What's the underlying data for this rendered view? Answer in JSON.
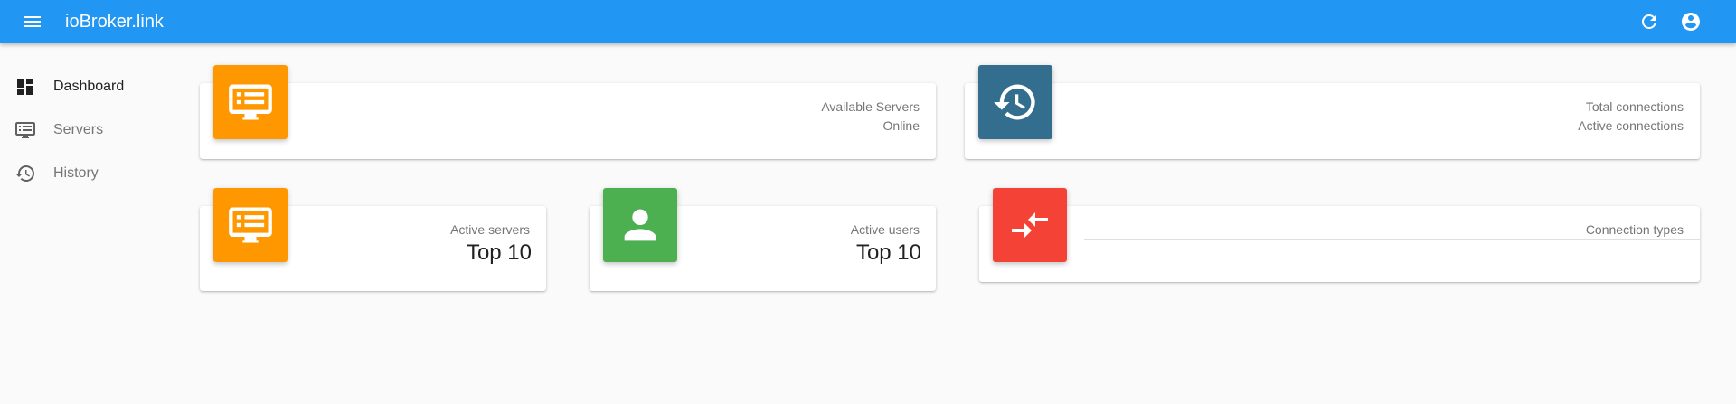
{
  "appbar": {
    "title": "ioBroker.link",
    "color": "#2196f3",
    "menu_icon": "menu-icon",
    "refresh_icon": "refresh-icon",
    "account_icon": "account-circle-icon"
  },
  "sidebar": {
    "items": [
      {
        "label": "Dashboard",
        "icon": "dashboard-icon",
        "active": true
      },
      {
        "label": "Servers",
        "icon": "servers-icon",
        "active": false
      },
      {
        "label": "History",
        "icon": "history-icon",
        "active": false
      }
    ]
  },
  "cards": {
    "available_servers": {
      "icon": "server-icon",
      "icon_color": "#ff9800",
      "line1": "Available Servers",
      "line2": "Online"
    },
    "connections": {
      "icon": "history-icon",
      "icon_color": "#336e8f",
      "line1": "Total connections",
      "line2": "Active connections"
    },
    "active_servers": {
      "icon": "server-icon",
      "icon_color": "#ff9800",
      "label": "Active servers",
      "value": "Top 10"
    },
    "active_users": {
      "icon": "person-icon",
      "icon_color": "#4caf50",
      "label": "Active users",
      "value": "Top 10"
    },
    "connection_types": {
      "icon": "compare-arrows-icon",
      "icon_color": "#f44336",
      "label": "Connection types"
    }
  }
}
